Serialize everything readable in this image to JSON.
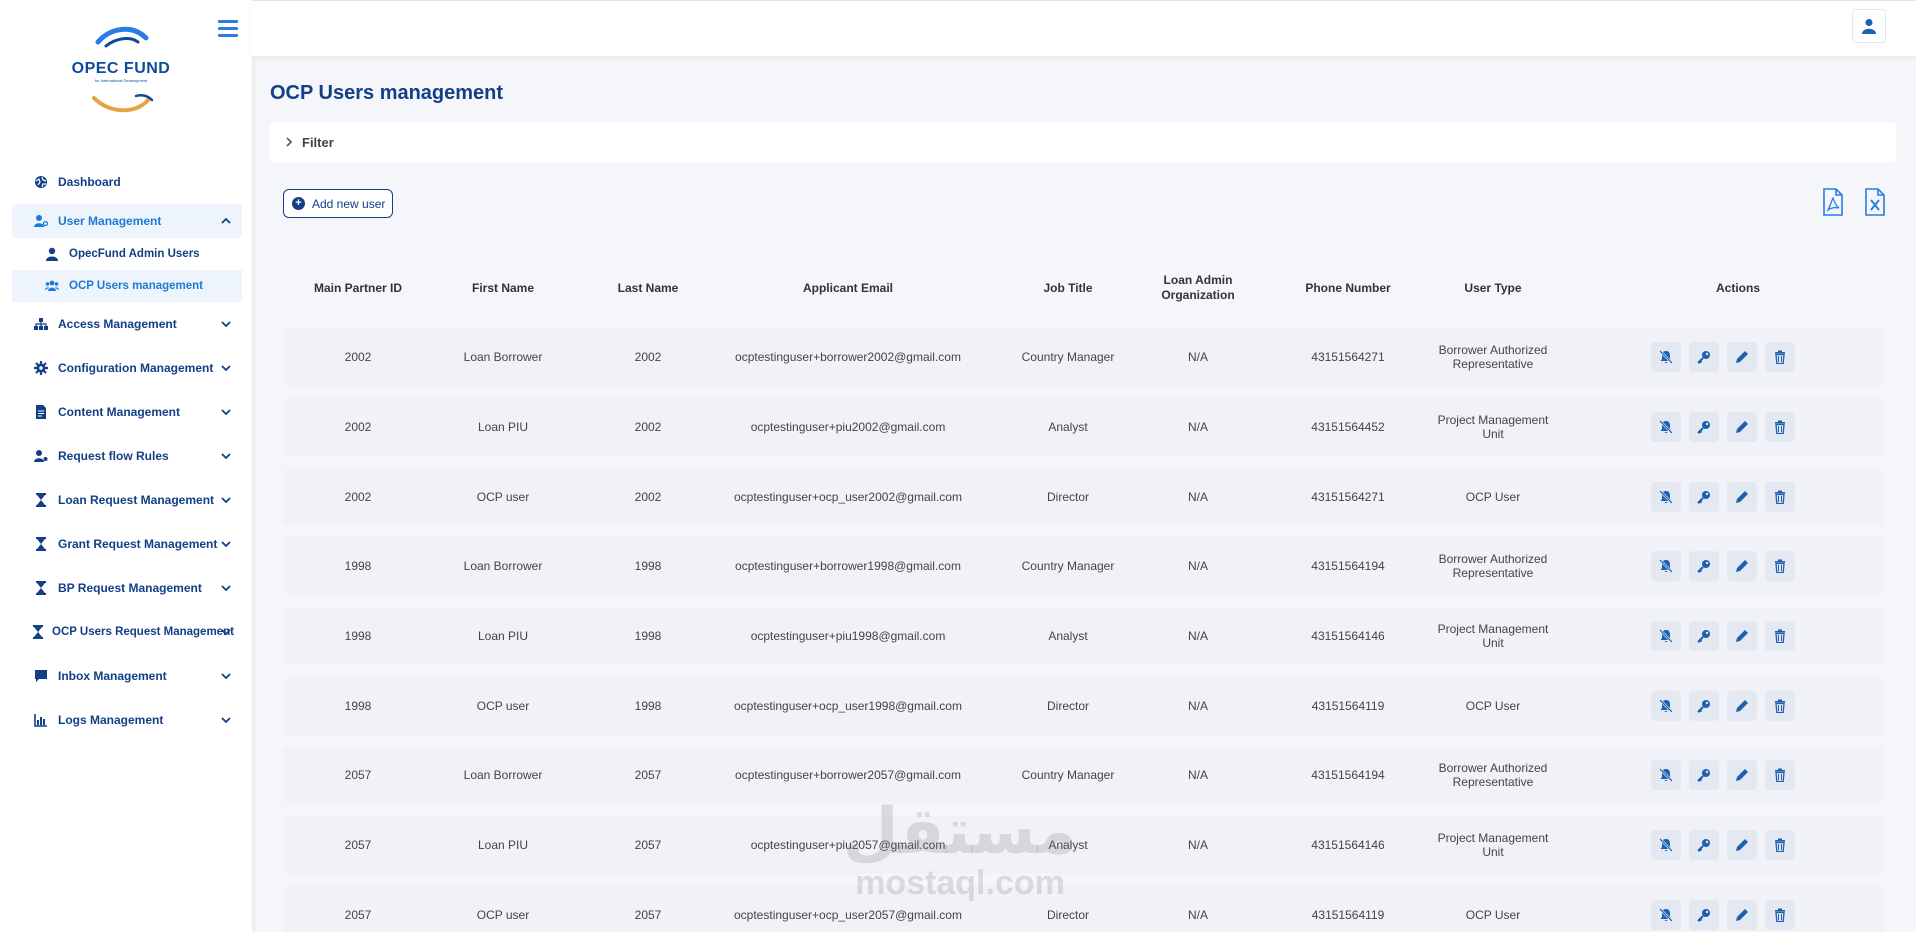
{
  "logo": {
    "title": "OPEC FUND",
    "subtitle": "for International Development"
  },
  "sidebar": {
    "items": [
      {
        "label": "Dashboard",
        "icon": "globe-icon"
      },
      {
        "label": "User Management",
        "icon": "users-cog-icon",
        "expanded": true,
        "children": [
          {
            "label": "OpecFund Admin Users",
            "icon": "user-icon"
          },
          {
            "label": "OCP Users management",
            "icon": "users-icon",
            "active": true
          }
        ]
      },
      {
        "label": "Access Management",
        "icon": "sitemap-icon"
      },
      {
        "label": "Configuration Management",
        "icon": "gear-icon"
      },
      {
        "label": "Content Management",
        "icon": "document-icon"
      },
      {
        "label": "Request flow Rules",
        "icon": "user-gear-icon"
      },
      {
        "label": "Loan Request Management",
        "icon": "hourglass-icon"
      },
      {
        "label": "Grant Request Management",
        "icon": "hourglass-icon"
      },
      {
        "label": "BP Request Management",
        "icon": "hourglass-icon"
      },
      {
        "label": "OCP Users Request Management",
        "icon": "hourglass-icon"
      },
      {
        "label": "Inbox Management",
        "icon": "message-icon"
      },
      {
        "label": "Logs Management",
        "icon": "chart-icon"
      }
    ]
  },
  "page": {
    "title": "OCP Users management"
  },
  "filter": {
    "label": "Filter"
  },
  "toolbar": {
    "add_label": "Add new user",
    "export_pdf": "pdf-export-icon",
    "export_excel": "excel-export-icon"
  },
  "table": {
    "headers": [
      "Main Partner ID",
      "First Name",
      "Last Name",
      "Applicant Email",
      "Job Title",
      "Loan Admin Organization",
      "Phone Number",
      "User Type",
      "Actions"
    ],
    "rows": [
      [
        "2002",
        "Loan Borrower",
        "2002",
        "ocptestinguser+borrower2002@gmail.com",
        "Country Manager",
        "N/A",
        "43151564271",
        "Borrower Authorized Representative"
      ],
      [
        "2002",
        "Loan PIU",
        "2002",
        "ocptestinguser+piu2002@gmail.com",
        "Analyst",
        "N/A",
        "43151564452",
        "Project Management Unit"
      ],
      [
        "2002",
        "OCP user",
        "2002",
        "ocptestinguser+ocp_user2002@gmail.com",
        "Director",
        "N/A",
        "43151564271",
        "OCP User"
      ],
      [
        "1998",
        "Loan Borrower",
        "1998",
        "ocptestinguser+borrower1998@gmail.com",
        "Country Manager",
        "N/A",
        "43151564194",
        "Borrower Authorized Representative"
      ],
      [
        "1998",
        "Loan PIU",
        "1998",
        "ocptestinguser+piu1998@gmail.com",
        "Analyst",
        "N/A",
        "43151564146",
        "Project Management Unit"
      ],
      [
        "1998",
        "OCP user",
        "1998",
        "ocptestinguser+ocp_user1998@gmail.com",
        "Director",
        "N/A",
        "43151564119",
        "OCP User"
      ],
      [
        "2057",
        "Loan Borrower",
        "2057",
        "ocptestinguser+borrower2057@gmail.com",
        "Country Manager",
        "N/A",
        "43151564194",
        "Borrower Authorized Representative"
      ],
      [
        "2057",
        "Loan PIU",
        "2057",
        "ocptestinguser+piu2057@gmail.com",
        "Analyst",
        "N/A",
        "43151564146",
        "Project Management Unit"
      ],
      [
        "2057",
        "OCP user",
        "2057",
        "ocptestinguser+ocp_user2057@gmail.com",
        "Director",
        "N/A",
        "43151564119",
        "OCP User"
      ]
    ],
    "row_actions": [
      "disable-notification-icon",
      "key-icon",
      "pencil-icon",
      "trash-icon"
    ]
  },
  "watermark": {
    "arabic": "مستقل",
    "latin": "mostaql.com"
  },
  "colors": {
    "primary": "#123f86",
    "accent": "#1d7ad8",
    "row_bg": "#f0f2f7"
  }
}
